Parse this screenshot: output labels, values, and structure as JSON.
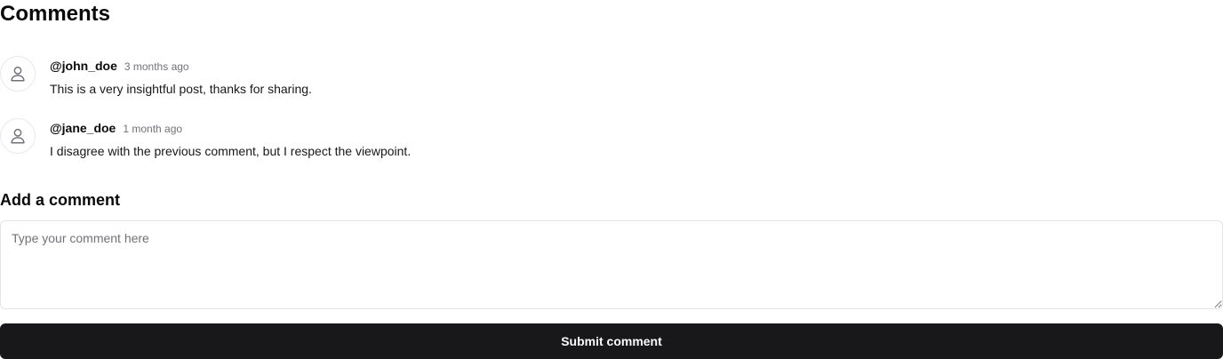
{
  "comments_section": {
    "title": "Comments",
    "items": [
      {
        "username": "@john_doe",
        "timestamp": "3 months ago",
        "text": "This is a very insightful post, thanks for sharing.",
        "avatar_icon": "user-icon"
      },
      {
        "username": "@jane_doe",
        "timestamp": "1 month ago",
        "text": "I disagree with the previous comment, but I respect the viewpoint.",
        "avatar_icon": "user-icon"
      }
    ]
  },
  "add_comment": {
    "title": "Add a comment",
    "input_value": "",
    "input_placeholder": "Type your comment here",
    "submit_label": "Submit comment"
  },
  "colors": {
    "button_bg": "#18181b",
    "button_text": "#fafafa",
    "muted_text": "#71717a",
    "border": "#e4e4e7"
  }
}
